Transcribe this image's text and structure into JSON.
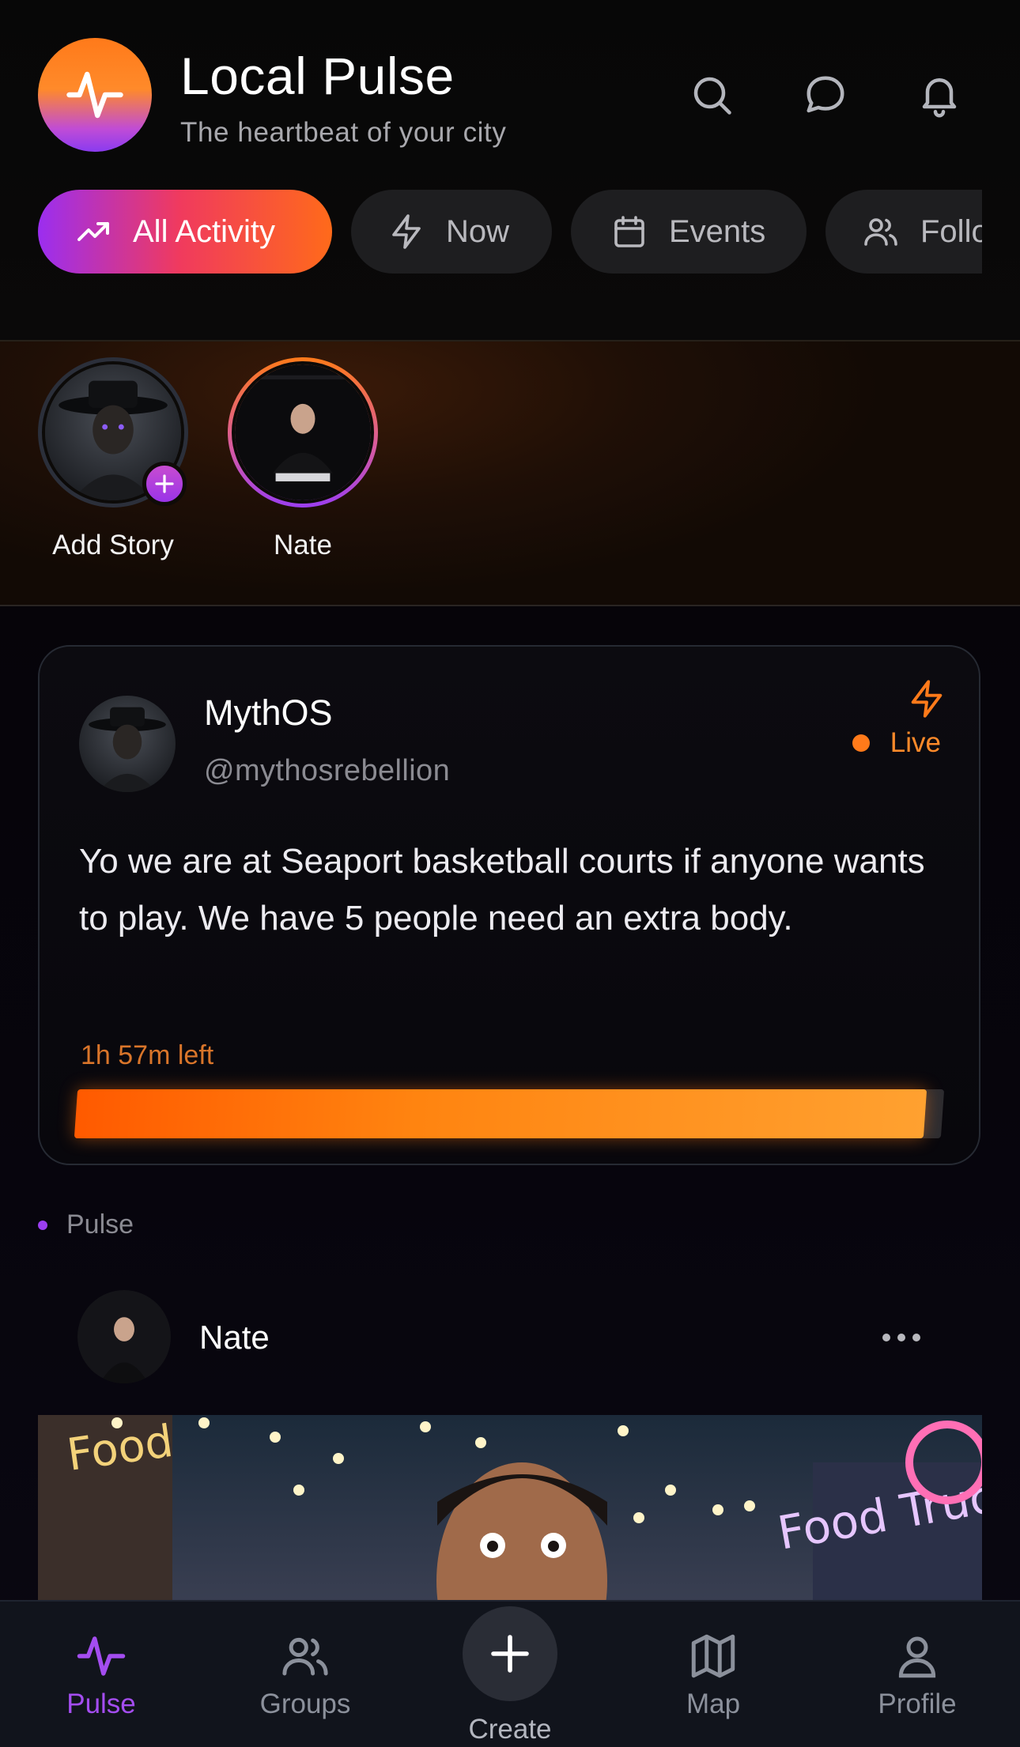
{
  "header": {
    "title": "Local Pulse",
    "subtitle": "The heartbeat of your city",
    "logo_icon": "pulse-line-icon",
    "actions": [
      "search-icon",
      "chat-bubble-icon",
      "bell-icon"
    ]
  },
  "filters": {
    "tabs": [
      {
        "label": "All Activity",
        "icon": "trending-up-icon",
        "active": true
      },
      {
        "label": "Now",
        "icon": "lightning-icon",
        "active": false
      },
      {
        "label": "Events",
        "icon": "calendar-icon",
        "active": false
      },
      {
        "label": "Follo",
        "icon": "users-icon",
        "active": false
      }
    ]
  },
  "stories": [
    {
      "label": "Add Story",
      "is_add": true
    },
    {
      "label": "Nate",
      "is_add": false
    }
  ],
  "live_post": {
    "author_name": "MythOS",
    "author_handle": "@mythosrebellion",
    "status": "Live",
    "body": "Yo we are at Seaport basketball courts if anyone wants to play. We have 5 people need an extra body.",
    "time_left": "1h 57m left",
    "time_remaining_fraction": 0.98
  },
  "section": {
    "label": "Pulse"
  },
  "post": {
    "author_name": "Nate",
    "more_icon": "more-horizontal-icon"
  },
  "bottom_nav": {
    "items": [
      {
        "label": "Pulse",
        "icon": "pulse-line-icon",
        "active": true
      },
      {
        "label": "Groups",
        "icon": "users-icon",
        "active": false
      },
      {
        "label": "Create",
        "icon": "plus-icon",
        "active": false
      },
      {
        "label": "Map",
        "icon": "map-icon",
        "active": false
      },
      {
        "label": "Profile",
        "icon": "user-icon",
        "active": false
      }
    ]
  },
  "colors": {
    "accent_purple": "#a44df0",
    "accent_orange": "#ff7a1a",
    "background": "#070707"
  }
}
